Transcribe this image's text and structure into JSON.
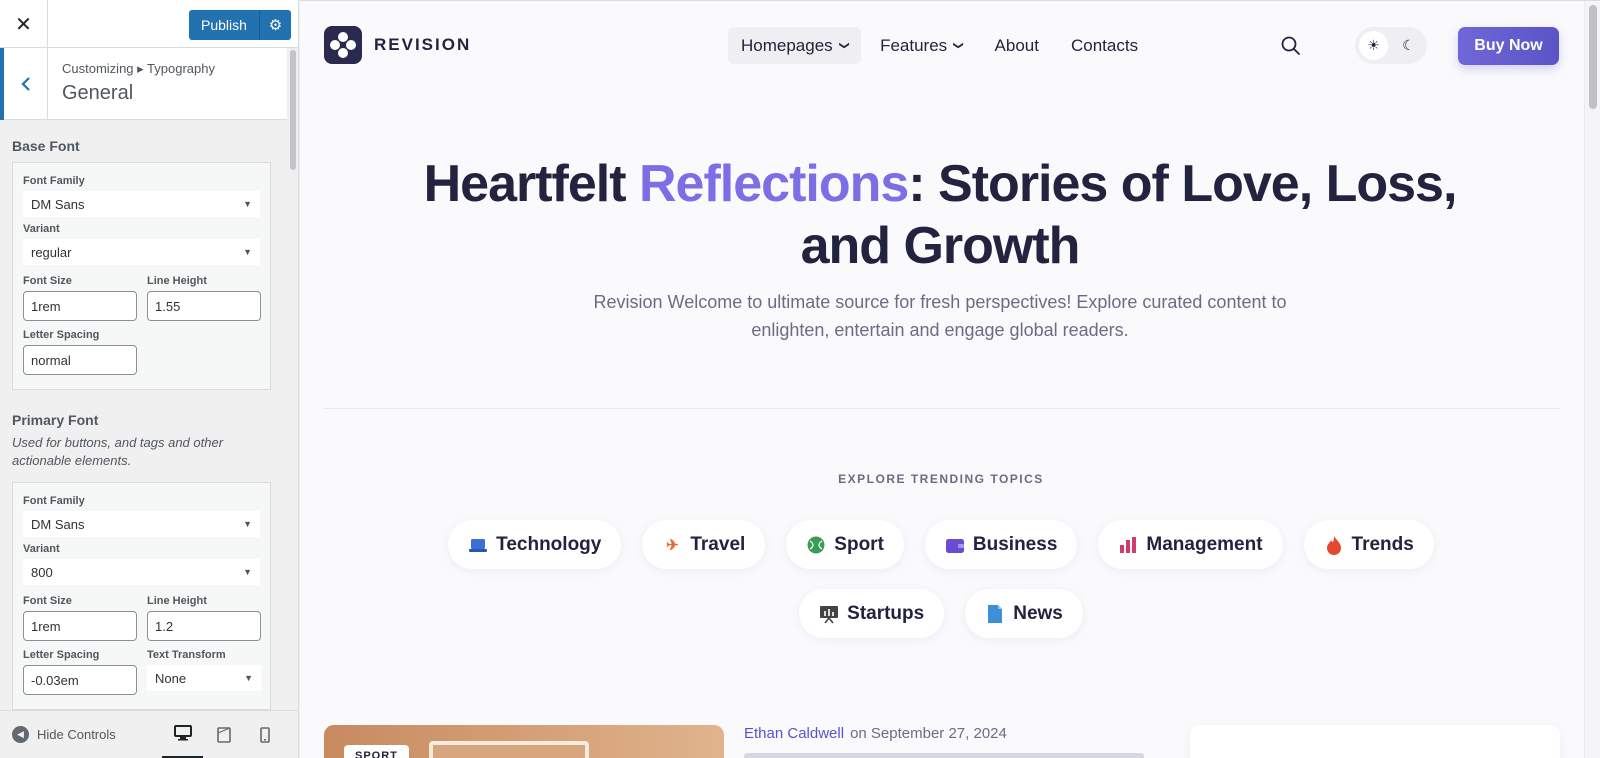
{
  "customizer": {
    "close_icon": "close-icon",
    "publish_label": "Publish",
    "breadcrumb": "Customizing ▸ Typography",
    "section_title": "General",
    "base_font": {
      "title": "Base Font",
      "font_family_label": "Font Family",
      "font_family_value": "DM Sans",
      "variant_label": "Variant",
      "variant_value": "regular",
      "font_size_label": "Font Size",
      "font_size_value": "1rem",
      "line_height_label": "Line Height",
      "line_height_value": "1.55",
      "letter_spacing_label": "Letter Spacing",
      "letter_spacing_value": "normal"
    },
    "primary_font": {
      "title": "Primary Font",
      "description": "Used for buttons, and tags and other actionable elements.",
      "font_family_label": "Font Family",
      "font_family_value": "DM Sans",
      "variant_label": "Variant",
      "variant_value": "800",
      "font_size_label": "Font Size",
      "font_size_value": "1rem",
      "line_height_label": "Line Height",
      "line_height_value": "1.2",
      "letter_spacing_label": "Letter Spacing",
      "letter_spacing_value": "-0.03em",
      "text_transform_label": "Text Transform",
      "text_transform_value": "None"
    },
    "footer": {
      "hide_controls_label": "Hide Controls",
      "devices": [
        "desktop",
        "tablet",
        "mobile"
      ],
      "active_device": "desktop"
    }
  },
  "site": {
    "logo_text": "REVISION",
    "nav": [
      {
        "label": "Homepages",
        "has_dropdown": true,
        "active": true
      },
      {
        "label": "Features",
        "has_dropdown": true,
        "active": false
      },
      {
        "label": "About",
        "has_dropdown": false,
        "active": false
      },
      {
        "label": "Contacts",
        "has_dropdown": false,
        "active": false
      }
    ],
    "buy_label": "Buy Now",
    "hero": {
      "title_before": "Heartfelt ",
      "title_accent": "Reflections",
      "title_after": ": Stories of Love, Loss, and Growth",
      "subtitle": "Revision Welcome to ultimate source for fresh perspectives! Explore curated content to enlighten, entertain and engage global readers."
    },
    "topics_title": "EXPLORE TRENDING TOPICS",
    "topics": [
      {
        "label": "Technology",
        "icon": "laptop-icon",
        "color": "#3b6fd8"
      },
      {
        "label": "Travel",
        "icon": "airplane-icon",
        "color": "#e46b2e"
      },
      {
        "label": "Sport",
        "icon": "ball-icon",
        "color": "#3c9a57"
      },
      {
        "label": "Business",
        "icon": "wallet-icon",
        "color": "#6a4bd1"
      },
      {
        "label": "Management",
        "icon": "bar-chart-icon",
        "color": "#d23a6e"
      },
      {
        "label": "Trends",
        "icon": "fire-icon",
        "color": "#e4482e"
      },
      {
        "label": "Startups",
        "icon": "presentation-icon",
        "color": "#444"
      },
      {
        "label": "News",
        "icon": "document-icon",
        "color": "#3d8fd8"
      }
    ],
    "post": {
      "tag": "SPORT",
      "author": "Ethan Caldwell",
      "date": "on September 27, 2024"
    },
    "colors": {
      "accent": "#7c6fe6",
      "dark": "#23233f",
      "wp_blue": "#2271b1"
    }
  }
}
